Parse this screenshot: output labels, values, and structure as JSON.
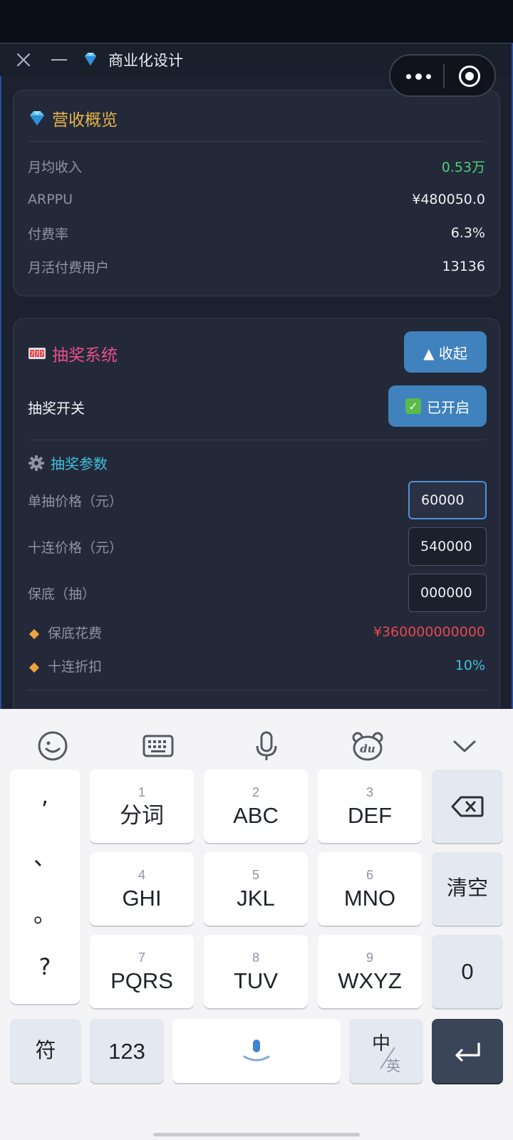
{
  "window": {
    "title": "商业化设计"
  },
  "revenue": {
    "title": "营收概览",
    "rows": [
      {
        "label": "月均收入",
        "value": "0.53万"
      },
      {
        "label": "ARPPU",
        "value": "¥480050.0"
      },
      {
        "label": "付费率",
        "value": "6.3%"
      },
      {
        "label": "月活付费用户",
        "value": "13136"
      }
    ]
  },
  "lottery": {
    "title": "抽奖系统",
    "collapse_label": "▲ 收起",
    "switch_label": "抽奖开关",
    "switch_state": "已开启",
    "params_title": "抽奖参数",
    "single_price_label": "单抽价格（元）",
    "single_price_value": "60000",
    "ten_price_label": "十连价格（元）",
    "ten_price_value": "540000",
    "pity_label": "保底（抽）",
    "pity_value": "000000",
    "pity_cost_label": "保底花费",
    "pity_cost_value": "¥360000000000",
    "ten_discount_label": "十连折扣",
    "ten_discount_value": "10%"
  },
  "keyboard": {
    "punct": [
      ",",
      "、",
      "。",
      "?"
    ],
    "keys": [
      {
        "num": "1",
        "label": "分词"
      },
      {
        "num": "2",
        "label": "ABC"
      },
      {
        "num": "3",
        "label": "DEF"
      },
      {
        "num": "4",
        "label": "GHI"
      },
      {
        "num": "5",
        "label": "JKL"
      },
      {
        "num": "6",
        "label": "MNO"
      },
      {
        "num": "7",
        "label": "PQRS"
      },
      {
        "num": "8",
        "label": "TUV"
      },
      {
        "num": "9",
        "label": "WXYZ"
      }
    ],
    "clear_label": "清空",
    "zero_label": "0",
    "symbol_label": "符",
    "num_label": "123",
    "lang_top": "中",
    "lang_bottom": "英"
  }
}
